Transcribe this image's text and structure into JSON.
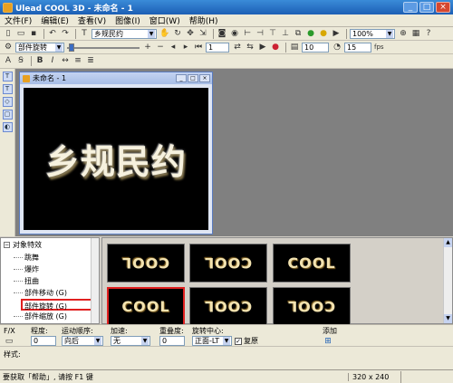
{
  "window": {
    "title": "Ulead COOL 3D - 未命名 - 1",
    "min": "_",
    "max": "□",
    "close": "×"
  },
  "menu": [
    "文件(F)",
    "编辑(E)",
    "查看(V)",
    "图像(I)",
    "窗口(W)",
    "帮助(H)"
  ],
  "toolbar1": {
    "text_combo": "乡规民约",
    "zoom_combo": "100%"
  },
  "toolbar2": {
    "object_combo": "部件旋转",
    "frame_value": "1",
    "frame_total": "10",
    "fps_value": "15",
    "fps_label": "fps"
  },
  "document": {
    "title": "未命名 - 1",
    "canvas_text": "乡规民约"
  },
  "effects_tree": {
    "root": "对象特效",
    "items": [
      "跳舞",
      "爆炸",
      "扭曲",
      "部件移动 (G)",
      "部件旋转 (G)",
      "部件缩放 (G)"
    ],
    "selected_index": 4
  },
  "thumbnails": [
    {
      "text": "COOL",
      "rotate": 180
    },
    {
      "text": "COOL",
      "rotate": 180
    },
    {
      "text": "COOL",
      "rotate": 0
    },
    {
      "text": "COOL",
      "rotate": 0
    },
    {
      "text": "COOL",
      "rotate": 180
    },
    {
      "text": "COOL",
      "rotate": 180
    }
  ],
  "thumbnails_selected": 3,
  "properties": {
    "fx_label": "F/X",
    "degree_label": "程度:",
    "degree_value": "0",
    "order_label": "运动顺序:",
    "order_value": "向后",
    "accel_label": "加速:",
    "accel_value": "无",
    "overlap_label": "重叠度:",
    "overlap_value": "0",
    "center_label": "旋转中心:",
    "center_value": "正面-LT",
    "repeat_label": "复原",
    "add_label": "添加"
  },
  "style": {
    "label": "样式:"
  },
  "status": {
    "text": "要获取「帮助」, 请按 F1 键",
    "size": "320 x 240"
  },
  "colors": {
    "accent": "#1c5fb5",
    "highlight": "#e02020"
  }
}
